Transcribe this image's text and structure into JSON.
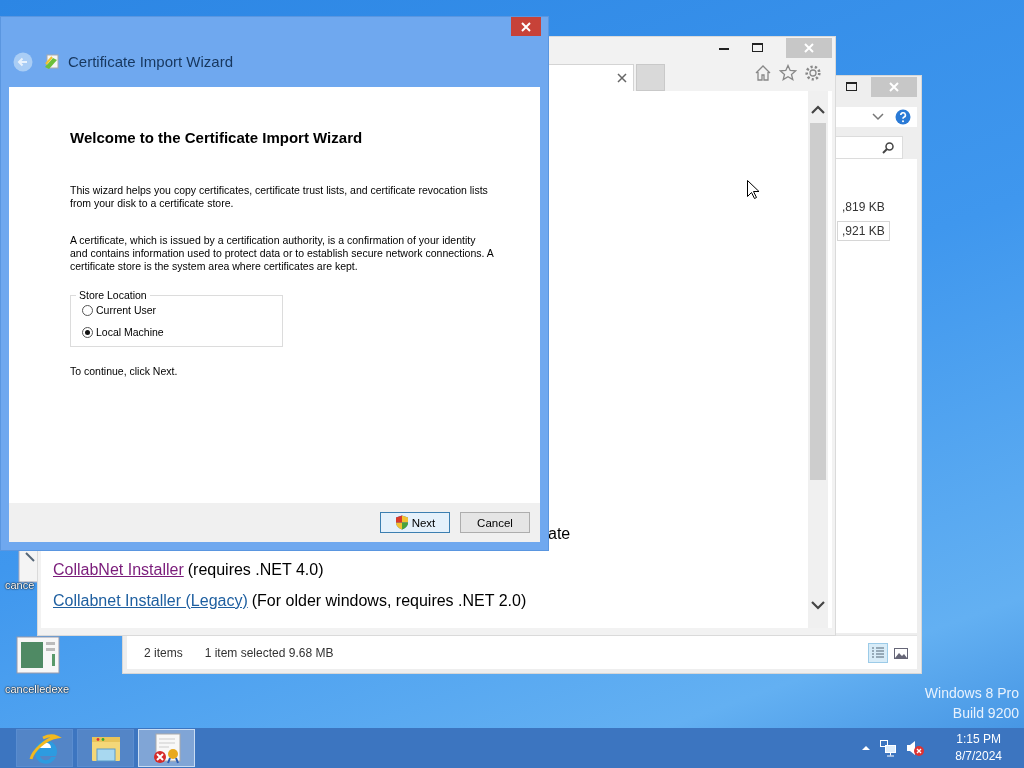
{
  "desktop": {
    "icons": [
      {
        "label": "cance"
      },
      {
        "label": "cancelledexe"
      }
    ],
    "watermark": [
      "Windows 8 Pro",
      "Build 9200"
    ]
  },
  "explorer_window": {
    "sizes": [
      {
        "text": ",819 KB",
        "selected": false
      },
      {
        "text": ",921 KB",
        "selected": true
      }
    ],
    "status_bar": {
      "count": "2 items",
      "selection": "1 item selected  9.68 MB"
    },
    "views": [
      {
        "kind": "details",
        "selected": true
      },
      {
        "kind": "preview",
        "selected": false
      }
    ]
  },
  "browser_window": {
    "partial_text": "ate",
    "links": [
      {
        "link": "CollabNet Installer",
        "visited": true,
        "note": "(requires .NET 4.0)"
      },
      {
        "link": "Collabnet Installer (Legacy)",
        "visited": false,
        "note": "(For older windows, requires .NET 2.0)"
      }
    ]
  },
  "dialog": {
    "title": "Certificate Import Wizard",
    "heading": "Welcome to the Certificate Import Wizard",
    "paragraphs": [
      "This wizard helps you copy certificates, certificate trust lists, and certificate revocation lists from your disk to a certificate store.",
      "A certificate, which is issued by a certification authority, is a confirmation of your identity and contains information used to protect data or to establish secure network connections. A certificate store is the system area where certificates are kept."
    ],
    "store_location": {
      "legend": "Store Location",
      "options": [
        {
          "label": "Current User",
          "selected": false
        },
        {
          "label": "Local Machine",
          "selected": true
        }
      ]
    },
    "hint": "To continue, click Next.",
    "buttons": [
      {
        "label": "Next",
        "kind": "shield",
        "default": true
      },
      {
        "label": "Cancel",
        "kind": "plain",
        "default": false
      }
    ]
  },
  "taskbar": {
    "apps": [
      {
        "kind": "browser",
        "active": false
      },
      {
        "kind": "folder",
        "active": false
      },
      {
        "kind": "certificate",
        "active": true
      }
    ],
    "clock": {
      "time": "1:15 PM",
      "date": "8/7/2024"
    }
  }
}
